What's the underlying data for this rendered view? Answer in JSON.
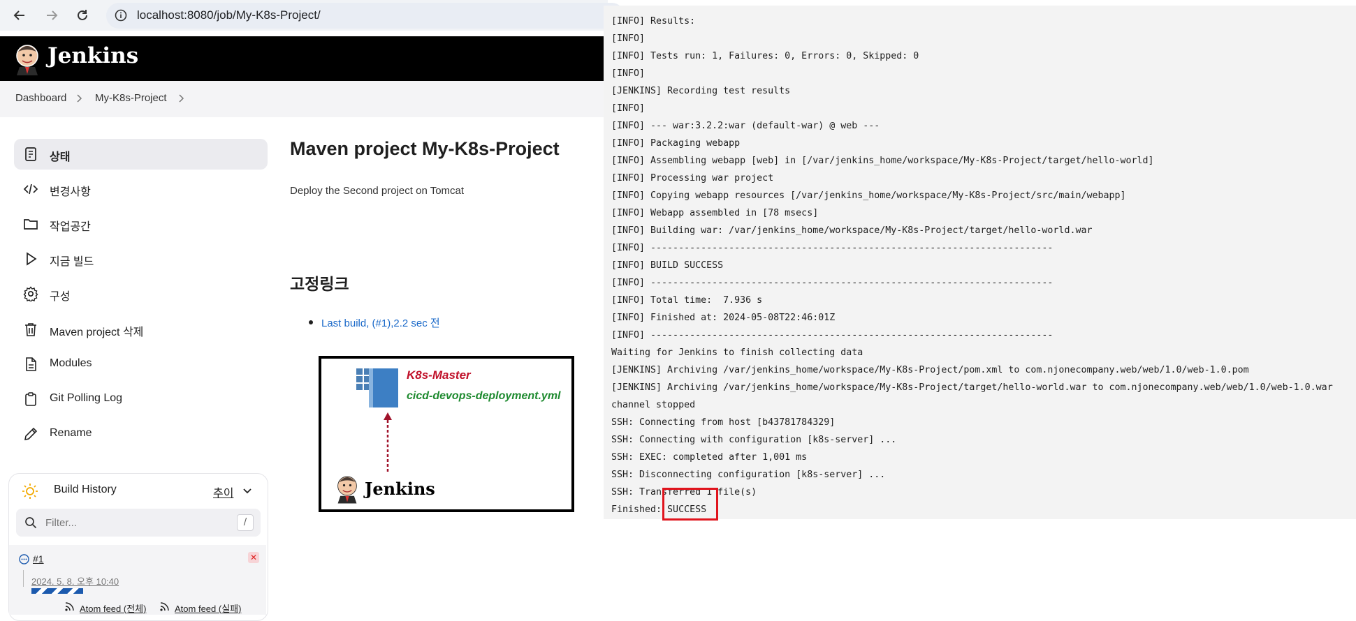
{
  "browser": {
    "url": "localhost:8080/job/My-K8s-Project/"
  },
  "header": {
    "title": "Jenkins"
  },
  "breadcrumb": {
    "items": [
      "Dashboard",
      "My-K8s-Project"
    ]
  },
  "sidebar": {
    "items": [
      {
        "label": "상태",
        "icon": "status-icon"
      },
      {
        "label": "변경사항",
        "icon": "code-icon"
      },
      {
        "label": "작업공간",
        "icon": "folder-icon"
      },
      {
        "label": "지금 빌드",
        "icon": "play-icon"
      },
      {
        "label": "구성",
        "icon": "gear-icon"
      },
      {
        "label": "Maven project 삭제",
        "icon": "trash-icon"
      },
      {
        "label": "Modules",
        "icon": "document-icon"
      },
      {
        "label": "Git Polling Log",
        "icon": "clipboard-icon"
      },
      {
        "label": "Rename",
        "icon": "pencil-icon"
      }
    ]
  },
  "build_history": {
    "title": "Build History",
    "trend_label": "추이",
    "filter_placeholder": "Filter...",
    "filter_shortcut": "/",
    "builds": [
      {
        "number": "#1",
        "date": "2024. 5. 8. 오후 10:40",
        "progress": 0.7
      }
    ],
    "feeds": [
      "Atom feed (전체)",
      "Atom feed (실패)"
    ]
  },
  "main": {
    "title": "Maven project My-K8s-Project",
    "description": "Deploy the Second project on Tomcat",
    "permalinks_title": "고정링크",
    "permalinks": [
      "Last build, (#1),2.2 sec 전"
    ],
    "diagram": {
      "master_label": "K8s-Master",
      "file_label": "cicd-devops-deployment.yml",
      "logo_text": "Jenkins"
    }
  },
  "console": {
    "lines": [
      "[INFO] Results:",
      "[INFO]",
      "[INFO] Tests run: 1, Failures: 0, Errors: 0, Skipped: 0",
      "[INFO]",
      "[JENKINS] Recording test results",
      "[INFO]",
      "[INFO] --- war:3.2.2:war (default-war) @ web ---",
      "[INFO] Packaging webapp",
      "[INFO] Assembling webapp [web] in [/var/jenkins_home/workspace/My-K8s-Project/target/hello-world]",
      "[INFO] Processing war project",
      "[INFO] Copying webapp resources [/var/jenkins_home/workspace/My-K8s-Project/src/main/webapp]",
      "[INFO] Webapp assembled in [78 msecs]",
      "[INFO] Building war: /var/jenkins_home/workspace/My-K8s-Project/target/hello-world.war",
      "[INFO] ------------------------------------------------------------------------",
      "[INFO] BUILD SUCCESS",
      "[INFO] ------------------------------------------------------------------------",
      "[INFO] Total time:  7.936 s",
      "[INFO] Finished at: 2024-05-08T22:46:01Z",
      "[INFO] ------------------------------------------------------------------------",
      "Waiting for Jenkins to finish collecting data",
      "[JENKINS] Archiving /var/jenkins_home/workspace/My-K8s-Project/pom.xml to com.njonecompany.web/web/1.0/web-1.0.pom",
      "[JENKINS] Archiving /var/jenkins_home/workspace/My-K8s-Project/target/hello-world.war to com.njonecompany.web/web/1.0/web-1.0.war",
      "channel stopped",
      "SSH: Connecting from host [b43781784329]",
      "SSH: Connecting with configuration [k8s-server] ...",
      "SSH: EXEC: completed after 1,001 ms",
      "SSH: Disconnecting configuration [k8s-server] ...",
      "SSH: Transferred 1 file(s)",
      "Finished: SUCCESS"
    ]
  },
  "colors": {
    "header_bg": "#000000",
    "link": "#1a69c9",
    "highlight": "#e0141d",
    "console_bg": "#f3f3f3"
  }
}
